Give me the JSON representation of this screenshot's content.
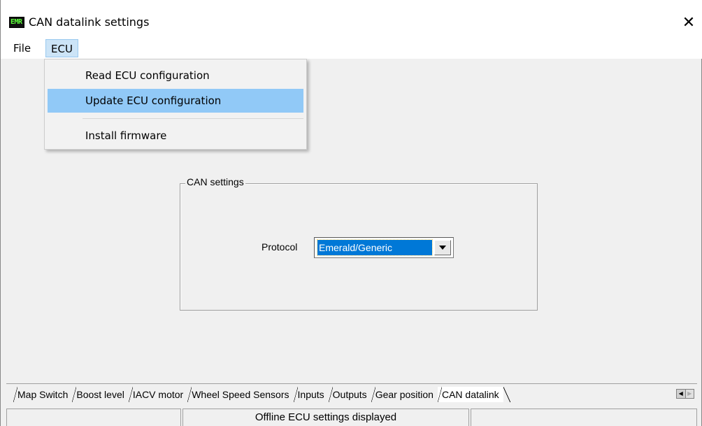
{
  "window": {
    "app_icon_text": "EMR",
    "title": "CAN datalink settings",
    "close_glyph": "✕"
  },
  "menubar": {
    "items": [
      {
        "label": "File"
      },
      {
        "label": "ECU"
      }
    ]
  },
  "ecu_menu": {
    "items": [
      {
        "label": "Read ECU configuration"
      },
      {
        "label": "Update ECU configuration"
      },
      {
        "label": "Install firmware"
      }
    ],
    "highlighted_index": 1
  },
  "can_settings": {
    "group_title": "CAN settings",
    "protocol_label": "Protocol",
    "protocol_value": "Emerald/Generic"
  },
  "tabs": {
    "items": [
      "Map Switch",
      "Boost level",
      "IACV motor",
      "Wheel Speed Sensors",
      "Inputs",
      "Outputs",
      "Gear position",
      "CAN datalink"
    ],
    "active": "CAN datalink"
  },
  "status": {
    "center_text": "Offline ECU settings displayed"
  },
  "colors": {
    "selection": "#0078d7",
    "menu_highlight": "#91c9f7",
    "menu_open": "#cce4f7",
    "icon_text": "#5cff3a"
  }
}
